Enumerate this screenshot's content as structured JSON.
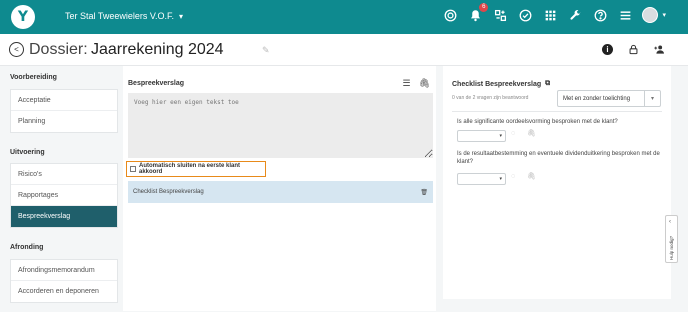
{
  "header": {
    "logo": "Y",
    "company": "Ter Stal Tweewielers V.O.F.",
    "notification_count": "6",
    "icons": [
      "target-icon",
      "bell-icon",
      "swap-icon",
      "check-circle-icon",
      "apps-grid-icon",
      "wrench-icon",
      "help-icon",
      "menu-icon",
      "avatar"
    ]
  },
  "titlebar": {
    "label": "Dossier:",
    "value": "Jaarrekening 2024",
    "actions": [
      "info-icon",
      "lock-icon",
      "add-user-icon"
    ]
  },
  "sidebar": {
    "sections": [
      {
        "title": "Voorbereiding",
        "items": [
          "Acceptatie",
          "Planning"
        ]
      },
      {
        "title": "Uitvoering",
        "items": [
          "Risico's",
          "Rapportages",
          "Bespreekverslag"
        ]
      },
      {
        "title": "Afronding",
        "items": [
          "Afrondingsmemorandum",
          "Accorderen en deponeren"
        ]
      }
    ],
    "active": "Bespreekverslag"
  },
  "main": {
    "title": "Bespreekverslag",
    "placeholder": "Voeg hier een eigen tekst toe",
    "checkbox_label": "Automatisch sluiten na eerste klant akkoord",
    "checklist_label": "Checklist Bespreekverslag"
  },
  "right": {
    "title": "Checklist Bespreekverslag",
    "subtitle": "0 van de 2 vragen zijn beantwoord",
    "filter_value": "Met en zonder toelichting",
    "questions": [
      "Is alle significante oordeelsvorming besproken met de klant?",
      "Is de resultaatbestemming en eventuele dividenduitkering besproken met de klant?"
    ]
  },
  "help_tab": {
    "label": "Hulp nodig?"
  },
  "colors": {
    "brand": "#0e8a8f",
    "active_nav": "#1f5f6b",
    "highlight": "#e88a1a",
    "row_bg": "#d6e6f1"
  }
}
